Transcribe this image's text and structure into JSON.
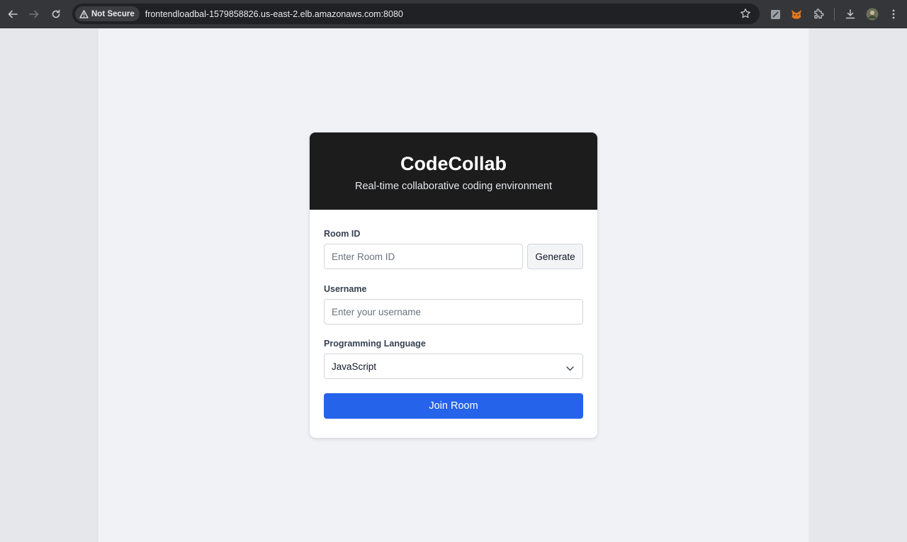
{
  "browser": {
    "security_label": "Not Secure",
    "url": "frontendloadbal-1579858826.us-east-2.elb.amazonaws.com:8080",
    "icons": [
      "back-icon",
      "forward-icon",
      "reload-icon",
      "warning-icon",
      "star-icon",
      "extension-notes-icon",
      "metamask-icon",
      "extensions-puzzle-icon",
      "download-icon",
      "profile-avatar",
      "menu-kebab-icon"
    ]
  },
  "app": {
    "title": "CodeCollab",
    "subtitle": "Real-time collaborative coding environment"
  },
  "form": {
    "room_id_label": "Room ID",
    "room_id_placeholder": "Enter Room ID",
    "room_id_value": "",
    "generate_label": "Generate",
    "username_label": "Username",
    "username_placeholder": "Enter your username",
    "username_value": "",
    "language_label": "Programming Language",
    "language_selected": "JavaScript",
    "join_label": "Join Room"
  },
  "colors": {
    "header_bg": "#1c1c1c",
    "primary": "#2563eb",
    "page_bg": "#f0f2f5"
  }
}
